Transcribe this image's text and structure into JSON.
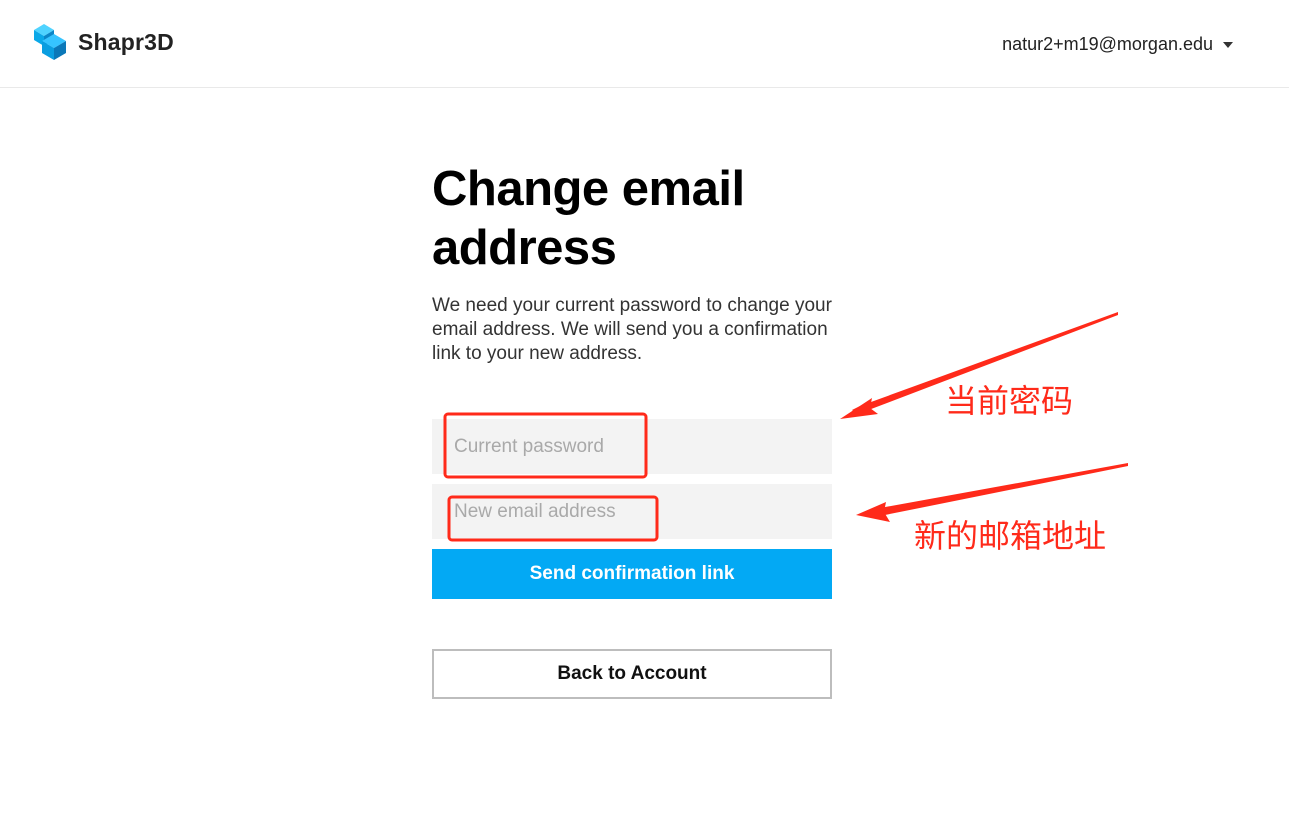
{
  "header": {
    "brand": "Shapr3D",
    "user_email": "natur2+m19@morgan.edu",
    "brand_color": "#03a9f4"
  },
  "main": {
    "title": "Change email address",
    "description": "We need your current password to change your email address. We will send you a confirmation link to your new address.",
    "current_password_placeholder": "Current password",
    "new_email_placeholder": "New email address",
    "send_button": "Send confirmation link",
    "back_button": "Back to Account",
    "accent": "#03a9f4"
  },
  "annotations": {
    "label_password": "当前密码",
    "label_email": "新的邮箱地址",
    "color": "#ff2a1a"
  }
}
